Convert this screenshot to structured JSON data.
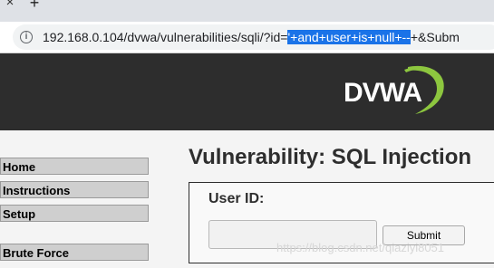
{
  "browser": {
    "close_glyph": "×",
    "new_tab_glyph": "+",
    "info_glyph": "i",
    "url_prefix": "192.168.0.104/dvwa/vulnerabilities/sqli/?id=",
    "url_selected": "'+and+user+is+null+--",
    "url_suffix": "+&Subm"
  },
  "header": {
    "logo_text": "DVWA",
    "logo_swoosh_color": "#8dc63f"
  },
  "menu": {
    "items": [
      {
        "label": "Home"
      },
      {
        "label": "Instructions"
      },
      {
        "label": "Setup"
      },
      {
        "label": "Brute Force"
      }
    ]
  },
  "main": {
    "title": "Vulnerability: SQL Injection",
    "user_id_label": "User ID:",
    "user_id_value": "",
    "submit_label": "Submit"
  },
  "watermark": "https://blog.csdn.net/qiaziyi8051"
}
